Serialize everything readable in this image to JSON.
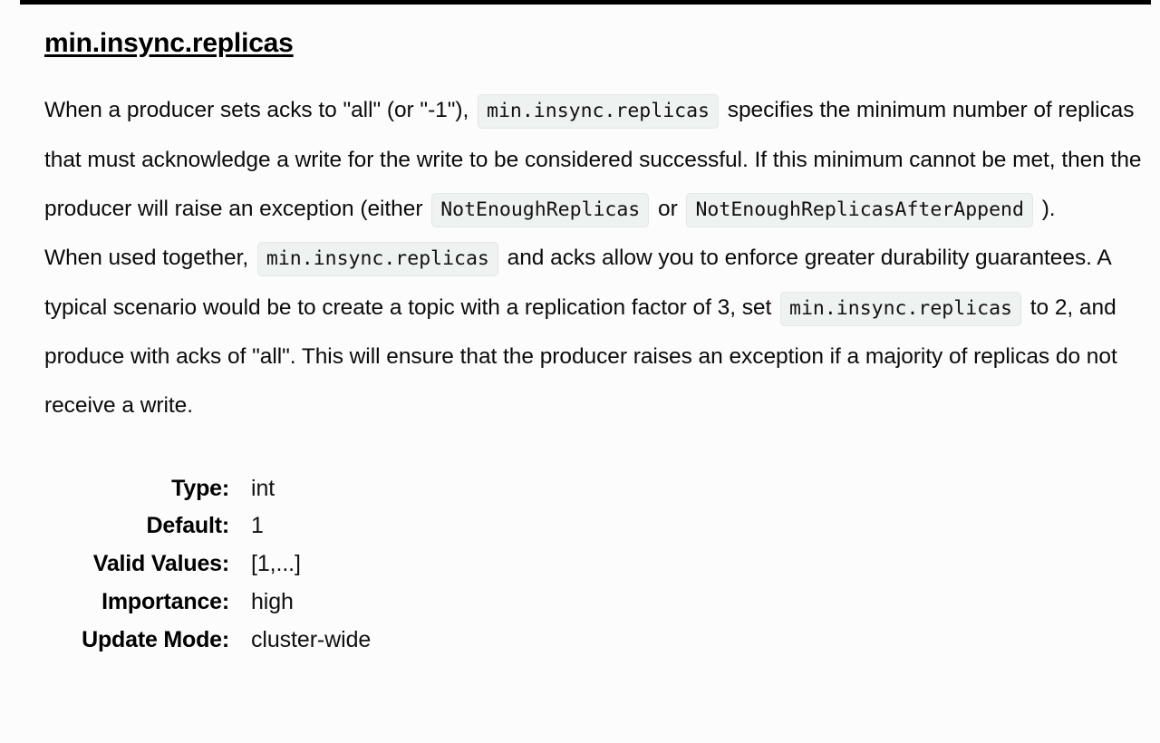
{
  "page": {
    "background_color": "#fcfcfc",
    "top_rule_color": "#000000",
    "code_background_color": "#eef2f1",
    "code_border_color": "#e2e8e6",
    "text_color": "#0b0b0b"
  },
  "config": {
    "name": "min.insync.replicas",
    "description": {
      "para1": {
        "seg1": "When a producer sets acks to \"all\" (or \"-1\"),",
        "code1": "min.insync.replicas",
        "seg2": "specifies the minimum number of replicas that must acknowledge a write for the write to be considered successful. If this minimum cannot be met, then the producer will raise an exception (either",
        "code2": "NotEnoughReplicas",
        "seg3": "or",
        "code3": "NotEnoughReplicasAfterAppend",
        "seg4": ")."
      },
      "para2": {
        "seg1": "When used together,",
        "code1": "min.insync.replicas",
        "seg2": "and acks allow you to enforce greater durability guarantees. A typical scenario would be to create a topic with a replication factor of 3, set",
        "code2": "min.insync.replicas",
        "seg3": "to 2, and produce with acks of \"all\". This will ensure that the producer raises an exception if a majority of replicas do not receive a write."
      }
    },
    "meta": {
      "type_label": "Type:",
      "type_value": "int",
      "default_label": "Default:",
      "default_value": "1",
      "valid_values_label": "Valid Values:",
      "valid_values_value": "[1,...]",
      "importance_label": "Importance:",
      "importance_value": "high",
      "update_mode_label": "Update Mode:",
      "update_mode_value": "cluster-wide"
    }
  }
}
